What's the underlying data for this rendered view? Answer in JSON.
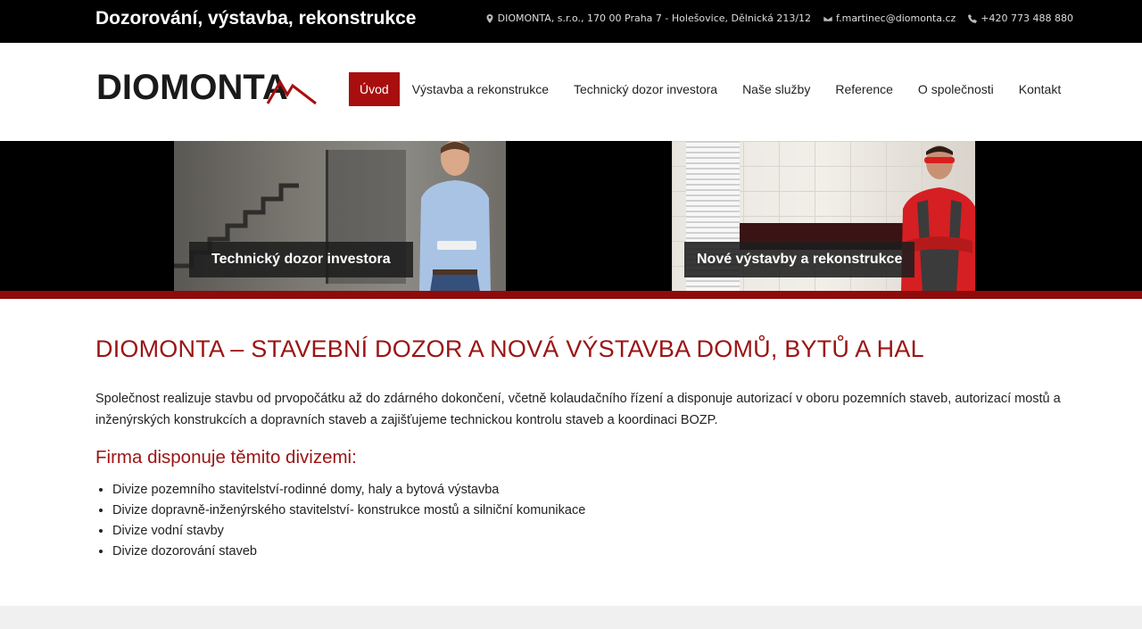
{
  "topbar": {
    "tagline": "Dozorování, výstavba, rekonstrukce",
    "address": "DIOMONTA, s.r.o., 170 00 Praha 7 - Holešovice, Dělnická 213/12",
    "email": "f.martinec@diomonta.cz",
    "phone": "+420 773 488 880",
    "icons": [
      "map-marker-icon",
      "envelope-icon",
      "phone-icon"
    ]
  },
  "logo": {
    "text": "DIOMONTA"
  },
  "nav": {
    "items": [
      {
        "label": "Úvod"
      },
      {
        "label": "Výstavba a rekonstrukce"
      },
      {
        "label": "Technický dozor investora"
      },
      {
        "label": "Naše služby"
      },
      {
        "label": "Reference"
      },
      {
        "label": "O společnosti"
      },
      {
        "label": "Kontakt"
      }
    ]
  },
  "hero": {
    "left_caption": "Technický dozor investora",
    "right_caption": "Nové výstavby a rekonstrukce"
  },
  "main": {
    "title": "DIOMONTA – STAVEBNÍ DOZOR A NOVÁ VÝSTAVBA DOMŮ, BYTŮ A HAL",
    "intro": "Společnost realizuje stavbu od prvopočátku až do zdárného dokončení, včetně kolaudačního řízení a disponuje autorizací v oboru pozemních staveb, autorizací mostů a inženýrských konstrukcích a dopravních staveb a zajišťujeme technickou kontrolu staveb a koordinaci BOZP.",
    "divisions_heading": "Firma disponuje těmito divizemi:",
    "divisions": [
      "Divize pozemního stavitelství-rodinné domy, haly a bytová výstavba",
      "Divize dopravně-inženýrského stavitelství- konstrukce mostů a silniční komunikace",
      "Divize vodní stavby",
      "Divize dozorování staveb"
    ]
  },
  "colors": {
    "brand_red": "#a80e0e",
    "heading_red": "#9b1414",
    "topbar_bg": "#000000"
  }
}
